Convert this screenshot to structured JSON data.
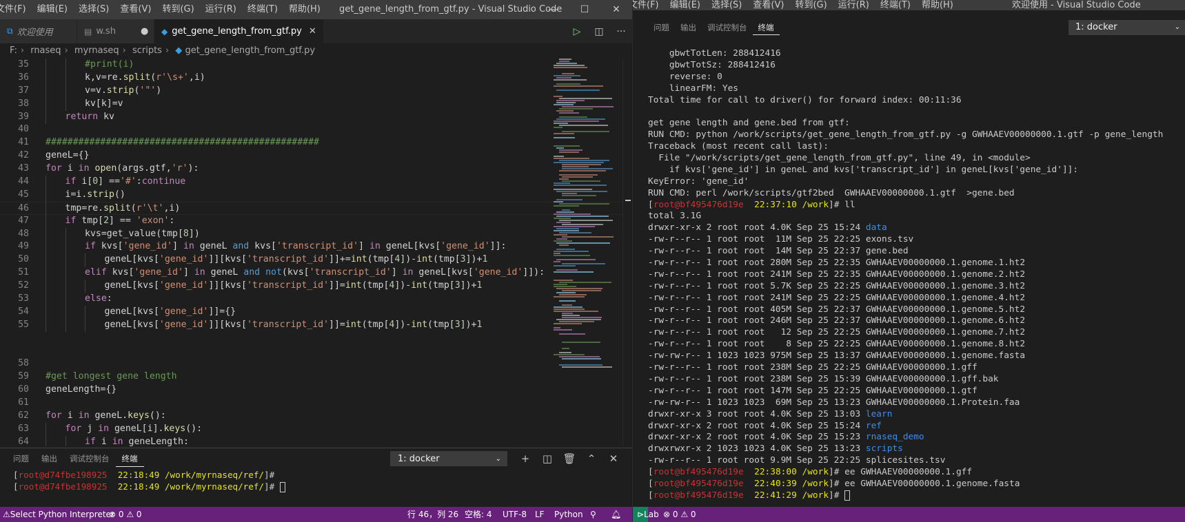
{
  "left_window": {
    "menu": [
      "文件(F)",
      "编辑(E)",
      "选择(S)",
      "查看(V)",
      "转到(G)",
      "运行(R)",
      "终端(T)",
      "帮助(H)"
    ],
    "title": "get_gene_length_from_gtf.py - Visual Studio Code",
    "tabs": [
      {
        "label": "欢迎使用",
        "icon": "vscode-logo-icon"
      },
      {
        "label": "w.sh",
        "icon": "shell-file-icon",
        "modified": true
      },
      {
        "label": "get_gene_length_from_gtf.py",
        "icon": "python-file-icon",
        "active": true
      }
    ],
    "breadcrumb": [
      "F:",
      "rnaseq",
      "myrnaseq",
      "scripts",
      "get_gene_length_from_gtf.py"
    ],
    "code_lines": [
      {
        "n": "35",
        "html": "<span class=\"cm\">#print(i)</span>",
        "indent": 2
      },
      {
        "n": "36",
        "html": "k,v=re.<span class=\"fn\">split</span>(<span class=\"str\">r'\\s+'</span>,i)",
        "indent": 2
      },
      {
        "n": "37",
        "html": "v=v.<span class=\"fn\">strip</span>(<span class=\"str\">'\"'</span>)",
        "indent": 2
      },
      {
        "n": "38",
        "html": "kv[k]=v",
        "indent": 2
      },
      {
        "n": "39",
        "html": "<span class=\"kw2\">return</span> kv",
        "indent": 1
      },
      {
        "n": "40",
        "html": "",
        "indent": 0
      },
      {
        "n": "41",
        "html": "<span class=\"cm\">##################################################</span>",
        "indent": 0
      },
      {
        "n": "42",
        "html": "geneL={}",
        "indent": 0
      },
      {
        "n": "43",
        "html": "<span class=\"kw2\">for</span> i <span class=\"kw2\">in</span> <span class=\"fn\">open</span>(args.gtf,<span class=\"str\">'r'</span>):",
        "indent": 0
      },
      {
        "n": "44",
        "html": "<span class=\"kw2\">if</span> i[<span class=\"num\">0</span>] ==<span class=\"str\">'#'</span>:<span class=\"kw2\">continue</span>",
        "indent": 1
      },
      {
        "n": "45",
        "html": "i=i.<span class=\"fn\">strip</span>()",
        "indent": 1
      },
      {
        "n": "46",
        "html": "tmp=re.<span class=\"fn\">split</span>(<span class=\"str\">r'\\t'</span>,i)",
        "indent": 1,
        "current": true
      },
      {
        "n": "47",
        "html": "<span class=\"kw2\">if</span> tmp[<span class=\"num\">2</span>] == <span class=\"str\">'exon'</span>:",
        "indent": 1
      },
      {
        "n": "48",
        "html": "kvs=get_value(tmp[<span class=\"num\">8</span>])",
        "indent": 2
      },
      {
        "n": "49",
        "html": "<span class=\"kw2\">if</span> kvs[<span class=\"str\">'gene_id'</span>] <span class=\"kw2\">in</span> geneL <span class=\"kw\">and</span> kvs[<span class=\"str\">'transcript_id'</span>] <span class=\"kw2\">in</span> geneL[kvs[<span class=\"str\">'gene_id'</span>]]:",
        "indent": 2
      },
      {
        "n": "50",
        "html": "geneL[kvs[<span class=\"str\">'gene_id'</span>]][kvs[<span class=\"str\">'transcript_id'</span>]]+=<span class=\"fn\">int</span>(tmp[<span class=\"num\">4</span>])-<span class=\"fn\">int</span>(tmp[<span class=\"num\">3</span>])+<span class=\"num\">1</span>",
        "indent": 3
      },
      {
        "n": "51",
        "html": "<span class=\"kw2\">elif</span> kvs[<span class=\"str\">'gene_id'</span>] <span class=\"kw2\">in</span> geneL <span class=\"kw\">and</span> <span class=\"kw\">not</span>(kvs[<span class=\"str\">'transcript_id'</span>] <span class=\"kw2\">in</span> geneL[kvs[<span class=\"str\">'gene_id'</span>]]):",
        "indent": 2
      },
      {
        "n": "52",
        "html": "geneL[kvs[<span class=\"str\">'gene_id'</span>]][kvs[<span class=\"str\">'transcript_id'</span>]]=<span class=\"fn\">int</span>(tmp[<span class=\"num\">4</span>])-<span class=\"fn\">int</span>(tmp[<span class=\"num\">3</span>])+<span class=\"num\">1</span>",
        "indent": 3
      },
      {
        "n": "53",
        "html": "<span class=\"kw2\">else</span>:",
        "indent": 2
      },
      {
        "n": "54",
        "html": "geneL[kvs[<span class=\"str\">'gene_id'</span>]]={}",
        "indent": 3
      },
      {
        "n": "55",
        "html": "geneL[kvs[<span class=\"str\">'gene_id'</span>]][kvs[<span class=\"str\">'transcript_id'</span>]]=<span class=\"fn\">int</span>(tmp[<span class=\"num\">4</span>])-<span class=\"fn\">int</span>(tmp[<span class=\"num\">3</span>])+<span class=\"num\">1</span>",
        "indent": 3
      },
      {
        "n": "",
        "html": "",
        "indent": 0
      },
      {
        "n": "",
        "html": "",
        "indent": 0
      },
      {
        "n": "58",
        "html": "",
        "indent": 0
      },
      {
        "n": "59",
        "html": "<span class=\"cm\">#get longest gene length</span>",
        "indent": 0
      },
      {
        "n": "60",
        "html": "geneLength={}",
        "indent": 0
      },
      {
        "n": "61",
        "html": "",
        "indent": 0
      },
      {
        "n": "62",
        "html": "<span class=\"kw2\">for</span> i <span class=\"kw2\">in</span> geneL.<span class=\"fn\">keys</span>():",
        "indent": 0
      },
      {
        "n": "63",
        "html": "<span class=\"kw2\">for</span> j <span class=\"kw2\">in</span> geneL[i].<span class=\"fn\">keys</span>():",
        "indent": 1
      },
      {
        "n": "64",
        "html": "<span class=\"kw2\">if</span> i <span class=\"kw2\">in</span> geneLength:",
        "indent": 2
      }
    ],
    "panel": {
      "tabs": [
        "问题",
        "输出",
        "调试控制台",
        "终端"
      ],
      "active_tab": "终端",
      "terminal_select": "1: docker",
      "lines": [
        {
          "user": "root",
          "host": "@d74fbe198925",
          "time": "22:18:49",
          "dir": "/work/myrnaseq/ref/",
          "cmd": ""
        },
        {
          "user": "root",
          "host": "@d74fbe198925",
          "time": "22:18:49",
          "dir": "/work/myrnaseq/ref/",
          "cmd": "",
          "cursor": true
        }
      ]
    },
    "status": {
      "interpreter": "Select Python Interpreter",
      "problems": "⊗ 0 ⚠ 0",
      "position": "行 46，列 26",
      "spaces": "空格: 4",
      "encoding": "UTF-8",
      "eol": "LF",
      "language": "Python"
    }
  },
  "right_window": {
    "menu": [
      "文件(F)",
      "编辑(E)",
      "选择(S)",
      "查看(V)",
      "转到(G)",
      "运行(R)",
      "终端(T)",
      "帮助(H)"
    ],
    "title": "欢迎使用 - Visual Studio Code",
    "panel_tabs": [
      "问题",
      "输出",
      "调试控制台",
      "终端"
    ],
    "active_tab": "终端",
    "terminal_select": "1: docker",
    "terminal_lines": [
      {
        "text": "    gbwtTotLen: 288412416"
      },
      {
        "text": "    gbwtTotSz: 288412416"
      },
      {
        "text": "    reverse: 0"
      },
      {
        "text": "    linearFM: Yes"
      },
      {
        "text": "Total time for call to driver() for forward index: 00:11:36"
      },
      {
        "text": ""
      },
      {
        "text": "get gene length and gene.bed from gtf:"
      },
      {
        "text": "RUN CMD: python /work/scripts/get_gene_length_from_gtf.py -g GWHAAEV00000000.1.gtf -p gene_length"
      },
      {
        "text": "Traceback (most recent call last):"
      },
      {
        "text": "  File \"/work/scripts/get_gene_length_from_gtf.py\", line 49, in <module>"
      },
      {
        "text": "    if kvs['gene_id'] in geneL and kvs['transcript_id'] in geneL[kvs['gene_id']]:"
      },
      {
        "text": "KeyError: 'gene_id'"
      },
      {
        "text": "RUN CMD: perl /work/scripts/gtf2bed  GWHAAEV00000000.1.gtf  >gene.bed"
      },
      {
        "prompt": true,
        "host": "@bf495476d19e",
        "time": "22:37:10",
        "dir": "/work",
        "cmd": "ll"
      },
      {
        "text": "total 3.1G"
      },
      {
        "text": "drwxr-xr-x 2 root root 4.0K Sep 25 15:24 ",
        "name": "data",
        "dir": true
      },
      {
        "text": "-rw-r--r-- 1 root root  11M Sep 25 22:25 ",
        "name": "exons.tsv"
      },
      {
        "text": "-rw-r--r-- 1 root root  14M Sep 25 22:37 ",
        "name": "gene.bed"
      },
      {
        "text": "-rw-r--r-- 1 root root 280M Sep 25 22:35 ",
        "name": "GWHAAEV00000000.1.genome.1.ht2"
      },
      {
        "text": "-rw-r--r-- 1 root root 241M Sep 25 22:35 ",
        "name": "GWHAAEV00000000.1.genome.2.ht2"
      },
      {
        "text": "-rw-r--r-- 1 root root 5.7K Sep 25 22:25 ",
        "name": "GWHAAEV00000000.1.genome.3.ht2"
      },
      {
        "text": "-rw-r--r-- 1 root root 241M Sep 25 22:25 ",
        "name": "GWHAAEV00000000.1.genome.4.ht2"
      },
      {
        "text": "-rw-r--r-- 1 root root 405M Sep 25 22:37 ",
        "name": "GWHAAEV00000000.1.genome.5.ht2"
      },
      {
        "text": "-rw-r--r-- 1 root root 246M Sep 25 22:37 ",
        "name": "GWHAAEV00000000.1.genome.6.ht2"
      },
      {
        "text": "-rw-r--r-- 1 root root   12 Sep 25 22:25 ",
        "name": "GWHAAEV00000000.1.genome.7.ht2"
      },
      {
        "text": "-rw-r--r-- 1 root root    8 Sep 25 22:25 ",
        "name": "GWHAAEV00000000.1.genome.8.ht2"
      },
      {
        "text": "-rw-rw-r-- 1 1023 1023 975M Sep 25 13:37 ",
        "name": "GWHAAEV00000000.1.genome.fasta"
      },
      {
        "text": "-rw-r--r-- 1 root root 238M Sep 25 22:25 ",
        "name": "GWHAAEV00000000.1.gff"
      },
      {
        "text": "-rw-r--r-- 1 root root 238M Sep 25 15:39 ",
        "name": "GWHAAEV00000000.1.gff.bak"
      },
      {
        "text": "-rw-r--r-- 1 root root 147M Sep 25 22:25 ",
        "name": "GWHAAEV00000000.1.gtf"
      },
      {
        "text": "-rw-rw-r-- 1 1023 1023  69M Sep 25 13:23 ",
        "name": "GWHAAEV00000000.1.Protein.faa"
      },
      {
        "text": "drwxr-xr-x 3 root root 4.0K Sep 25 13:03 ",
        "name": "learn",
        "dir": true
      },
      {
        "text": "drwxr-xr-x 2 root root 4.0K Sep 25 15:24 ",
        "name": "ref",
        "dir": true
      },
      {
        "text": "drwxr-xr-x 2 root root 4.0K Sep 25 15:23 ",
        "name": "rnaseq_demo",
        "dir": true
      },
      {
        "text": "drwxrwxr-x 2 1023 1023 4.0K Sep 25 13:23 ",
        "name": "scripts",
        "dir": true
      },
      {
        "text": "-rw-r--r-- 1 root root 9.9M Sep 25 22:25 ",
        "name": "splicesites.tsv"
      },
      {
        "prompt": true,
        "host": "@bf495476d19e",
        "time": "22:38:00",
        "dir": "/work",
        "cmd": "ee GWHAAEV00000000.1.gff"
      },
      {
        "prompt": true,
        "host": "@bf495476d19e",
        "time": "22:40:39",
        "dir": "/work",
        "cmd": "ee GWHAAEV00000000.1.genome.fasta"
      },
      {
        "prompt": true,
        "host": "@bf495476d19e",
        "time": "22:41:29",
        "dir": "/work",
        "cmd": "",
        "cursor": true
      }
    ],
    "status": {
      "remote": "Lab",
      "problems": "⊗ 0 ⚠ 0"
    }
  },
  "colors": {
    "statusbar": "#68217a",
    "editor_bg": "#1e1e1e",
    "prompt_user": "#cd3131",
    "prompt_time": "#e5e510",
    "dir_listing": "#3b8eea"
  }
}
